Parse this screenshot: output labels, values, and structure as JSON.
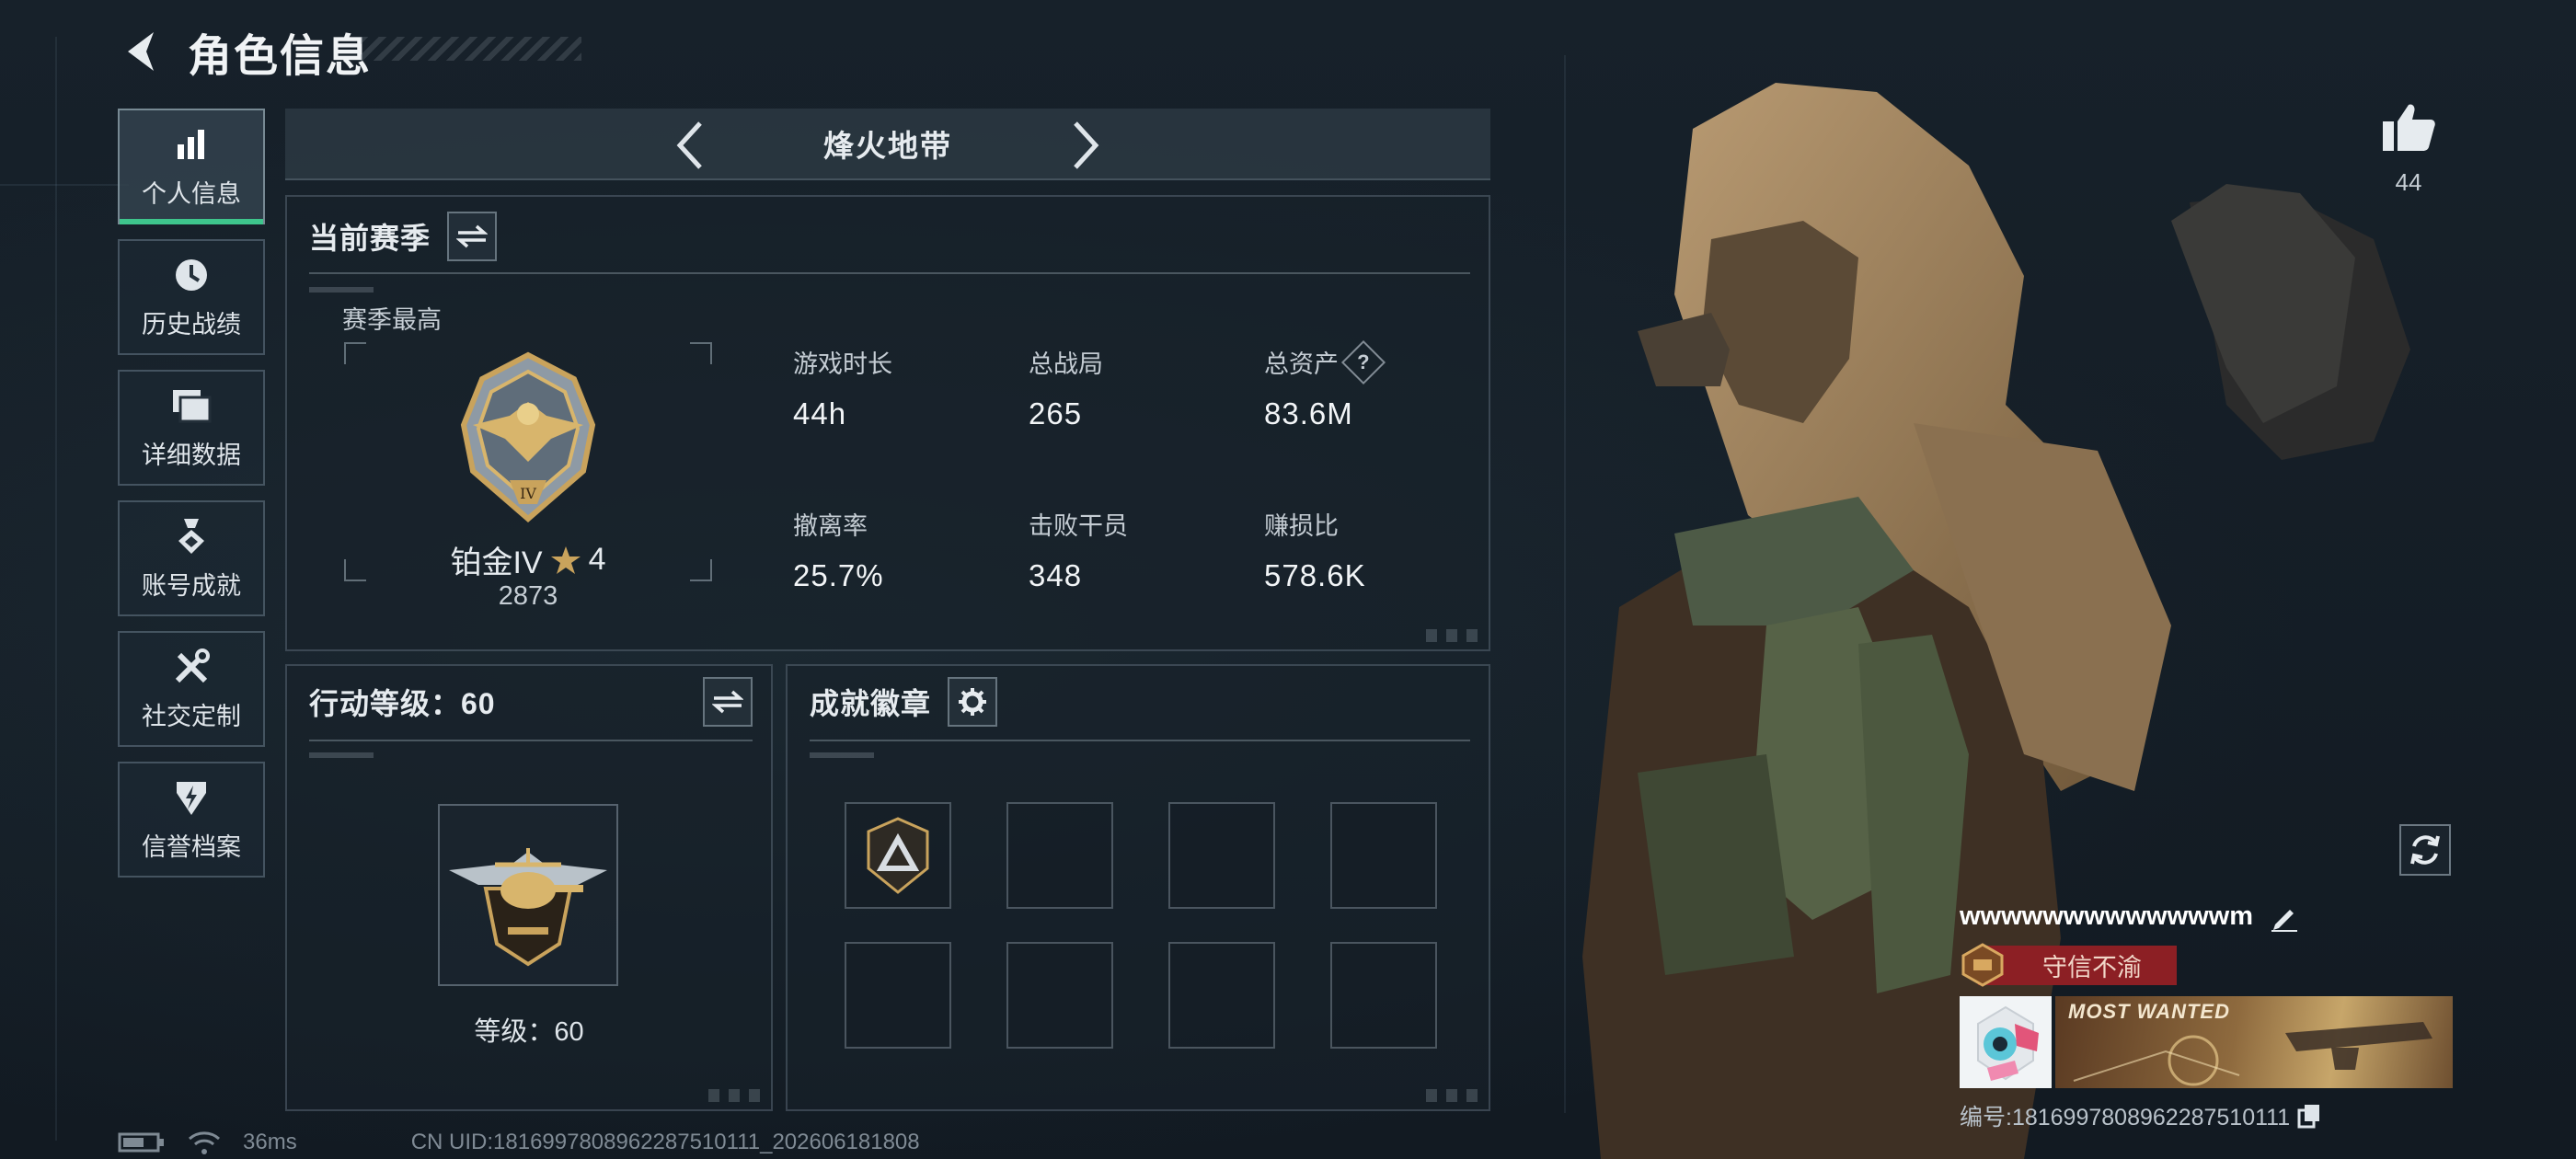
{
  "header": {
    "title": "角色信息"
  },
  "sidebar": {
    "items": [
      {
        "label": "个人信息",
        "icon": "bar-chart-icon",
        "active": true
      },
      {
        "label": "历史战绩",
        "icon": "history-clock-icon",
        "active": false
      },
      {
        "label": "详细数据",
        "icon": "folder-icon",
        "active": false
      },
      {
        "label": "账号成就",
        "icon": "achievement-medal-icon",
        "active": false
      },
      {
        "label": "社交定制",
        "icon": "tools-icon",
        "active": false
      },
      {
        "label": "信誉档案",
        "icon": "shield-bolt-icon",
        "active": false
      }
    ]
  },
  "mode": {
    "title": "烽火地带"
  },
  "season": {
    "title": "当前赛季",
    "subtitle": "赛季最高",
    "rank_name": "铂金IV",
    "rank_stars": "4",
    "rank_score": "2873",
    "stats": [
      {
        "label": "游戏时长",
        "value": "44h"
      },
      {
        "label": "总战局",
        "value": "265"
      },
      {
        "label": "总资产",
        "value": "83.6M",
        "help": "?"
      },
      {
        "label": "撤离率",
        "value": "25.7%"
      },
      {
        "label": "击败干员",
        "value": "348"
      },
      {
        "label": "赚损比",
        "value": "578.6K"
      }
    ]
  },
  "action_level": {
    "title": "行动等级：60",
    "caption": "等级：60"
  },
  "achievements": {
    "title": "成就徽章",
    "slots_filled": 1,
    "slots_total": 8
  },
  "likes": {
    "count": "44"
  },
  "player": {
    "name": "wwwwwwwwwwwwwm",
    "title_badge": "守信不渝",
    "banner_text": "MOST WANTED",
    "id_text": "编号:1816997808962287510111"
  },
  "status": {
    "ping": "36ms",
    "uid": "CN UID:1816997808962287510111_202606181808"
  },
  "colors": {
    "active_accent": "#3ec58c",
    "title_red": "#8c1f24",
    "medal_gold": "#c9a35c"
  }
}
